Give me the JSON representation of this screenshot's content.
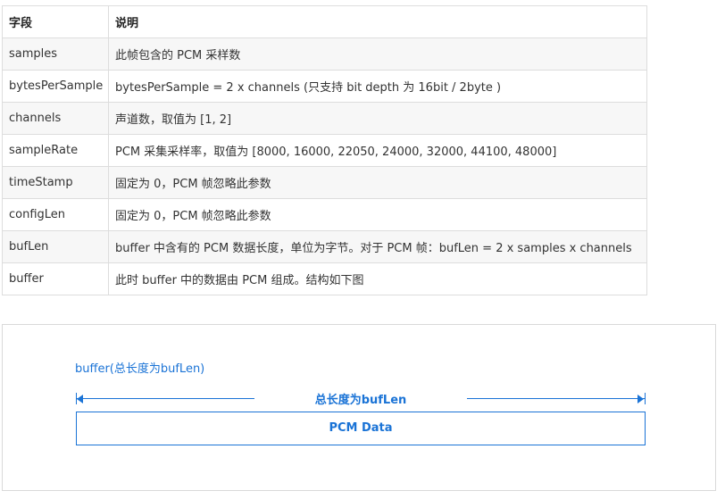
{
  "table": {
    "headers": [
      "字段",
      "说明"
    ],
    "rows": [
      {
        "field": "samples",
        "desc": "此帧包含的 PCM 采样数"
      },
      {
        "field": "bytesPerSample",
        "desc": "bytesPerSample = 2 x channels (只支持 bit depth 为 16bit / 2byte )"
      },
      {
        "field": "channels",
        "desc": "声道数，取值为 [1, 2]"
      },
      {
        "field": "sampleRate",
        "desc": "PCM 采集采样率，取值为 [8000, 16000, 22050, 24000, 32000, 44100, 48000]"
      },
      {
        "field": "timeStamp",
        "desc": "固定为 0，PCM 帧忽略此参数"
      },
      {
        "field": "configLen",
        "desc": "固定为 0，PCM 帧忽略此参数"
      },
      {
        "field": "bufLen",
        "desc": "buffer 中含有的 PCM 数据长度，单位为字节。对于 PCM 帧：bufLen = 2 x samples x channels"
      },
      {
        "field": "buffer",
        "desc": "此时 buffer 中的数据由 PCM 组成。结构如下图"
      }
    ]
  },
  "diagram": {
    "title": "buffer(总长度为bufLen)",
    "dimension_label": "总长度为bufLen",
    "box_label": "PCM Data",
    "accent_color": "#1a73d6"
  }
}
